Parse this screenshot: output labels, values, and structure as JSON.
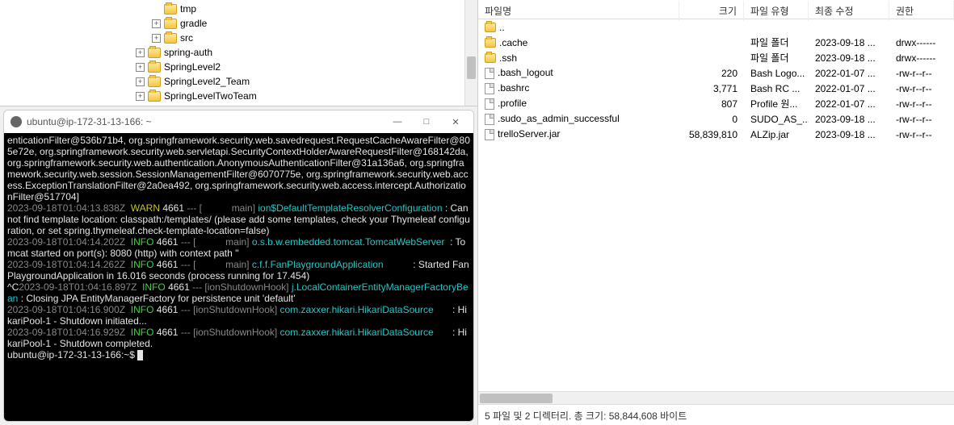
{
  "tree": {
    "items": [
      {
        "label": "tmp",
        "level": 2,
        "expander": ""
      },
      {
        "label": "gradle",
        "level": 2,
        "expander": "+"
      },
      {
        "label": "src",
        "level": 2,
        "expander": "+"
      },
      {
        "label": "spring-auth",
        "level": 1,
        "expander": "+"
      },
      {
        "label": "SpringLevel2",
        "level": 1,
        "expander": "+"
      },
      {
        "label": "SpringLevel2_Team",
        "level": 1,
        "expander": "+"
      },
      {
        "label": "SpringLevelTwoTeam",
        "level": 1,
        "expander": "+"
      }
    ]
  },
  "terminal": {
    "title": "ubuntu@ip-172-31-13-166: ~",
    "lines": [
      {
        "segments": [
          {
            "cls": "t-white",
            "text": "enticationFilter@536b71b4, org.springframework.security.web.savedrequest.RequestCacheAwareFilter@805e72e, org.springframework.security.web.servletapi.SecurityContextHolderAwareRequestFilter@168142da, org.springframework.security.web.authentication.AnonymousAuthenticationFilter@31a136a6, org.springframework.security.web.session.SessionManagementFilter@6070775e, org.springframework.security.web.access.ExceptionTranslationFilter@2a0ea492, org.springframework.security.web.access.intercept.AuthorizationFilter@517704]"
          }
        ]
      },
      {
        "segments": [
          {
            "cls": "t-grey",
            "text": "2023-09-18T01:04:13.838Z"
          },
          {
            "cls": "t-yellow",
            "text": "  WARN "
          },
          {
            "cls": "t-white",
            "text": "4661 "
          },
          {
            "cls": "t-grey",
            "text": "--- [           main] "
          },
          {
            "cls": "t-teal",
            "text": "ion$DefaultTemplateResolverConfiguration "
          },
          {
            "cls": "t-white",
            "text": ": Cannot find template location: classpath:/templates/ (please add some templates, check your Thymeleaf configuration, or set spring.thymeleaf.check-template-location=false)"
          }
        ]
      },
      {
        "segments": [
          {
            "cls": "t-grey",
            "text": "2023-09-18T01:04:14.202Z"
          },
          {
            "cls": "t-green",
            "text": "  INFO "
          },
          {
            "cls": "t-white",
            "text": "4661 "
          },
          {
            "cls": "t-grey",
            "text": "--- [           main] "
          },
          {
            "cls": "t-teal",
            "text": "o.s.b.w.embedded.tomcat.TomcatWebServer  "
          },
          {
            "cls": "t-white",
            "text": ": Tomcat started on port(s): 8080 (http) with context path ''"
          }
        ]
      },
      {
        "segments": [
          {
            "cls": "t-grey",
            "text": "2023-09-18T01:04:14.262Z"
          },
          {
            "cls": "t-green",
            "text": "  INFO "
          },
          {
            "cls": "t-white",
            "text": "4661 "
          },
          {
            "cls": "t-grey",
            "text": "--- [           main] "
          },
          {
            "cls": "t-teal",
            "text": "c.f.f.FanPlaygroundApplication           "
          },
          {
            "cls": "t-white",
            "text": ": Started FanPlaygroundApplication in 16.016 seconds (process running for 17.454)"
          }
        ]
      },
      {
        "segments": [
          {
            "cls": "t-white",
            "text": "^C"
          },
          {
            "cls": "t-grey",
            "text": "2023-09-18T01:04:16.897Z"
          },
          {
            "cls": "t-green",
            "text": "  INFO "
          },
          {
            "cls": "t-white",
            "text": "4661 "
          },
          {
            "cls": "t-grey",
            "text": "--- [ionShutdownHook] "
          },
          {
            "cls": "t-teal",
            "text": "j.LocalContainerEntityManagerFactoryBean "
          },
          {
            "cls": "t-white",
            "text": ": Closing JPA EntityManagerFactory for persistence unit 'default'"
          }
        ]
      },
      {
        "segments": [
          {
            "cls": "t-grey",
            "text": "2023-09-18T01:04:16.900Z"
          },
          {
            "cls": "t-green",
            "text": "  INFO "
          },
          {
            "cls": "t-white",
            "text": "4661 "
          },
          {
            "cls": "t-grey",
            "text": "--- [ionShutdownHook] "
          },
          {
            "cls": "t-teal",
            "text": "com.zaxxer.hikari.HikariDataSource       "
          },
          {
            "cls": "t-white",
            "text": ": HikariPool-1 - Shutdown initiated..."
          }
        ]
      },
      {
        "segments": [
          {
            "cls": "t-grey",
            "text": "2023-09-18T01:04:16.929Z"
          },
          {
            "cls": "t-green",
            "text": "  INFO "
          },
          {
            "cls": "t-white",
            "text": "4661 "
          },
          {
            "cls": "t-grey",
            "text": "--- [ionShutdownHook] "
          },
          {
            "cls": "t-teal",
            "text": "com.zaxxer.hikari.HikariDataSource       "
          },
          {
            "cls": "t-white",
            "text": ": HikariPool-1 - Shutdown completed."
          }
        ]
      },
      {
        "segments": [
          {
            "cls": "t-white",
            "text": "ubuntu@ip-172-31-13-166:~$ "
          }
        ],
        "cursor": true
      }
    ]
  },
  "file_list": {
    "headers": {
      "name": "파일명",
      "size": "크기",
      "type": "파일 유형",
      "date": "최종 수정",
      "perm": "권한"
    },
    "rows": [
      {
        "icon": "folder",
        "name": "..",
        "size": "",
        "type": "",
        "date": "",
        "perm": ""
      },
      {
        "icon": "folder",
        "name": ".cache",
        "size": "",
        "type": "파일 폴더",
        "date": "2023-09-18 ...",
        "perm": "drwx------"
      },
      {
        "icon": "folder",
        "name": ".ssh",
        "size": "",
        "type": "파일 폴더",
        "date": "2023-09-18 ...",
        "perm": "drwx------"
      },
      {
        "icon": "file",
        "name": ".bash_logout",
        "size": "220",
        "type": "Bash Logo...",
        "date": "2022-01-07 ...",
        "perm": "-rw-r--r--"
      },
      {
        "icon": "file",
        "name": ".bashrc",
        "size": "3,771",
        "type": "Bash RC ...",
        "date": "2022-01-07 ...",
        "perm": "-rw-r--r--"
      },
      {
        "icon": "file",
        "name": ".profile",
        "size": "807",
        "type": "Profile 원...",
        "date": "2022-01-07 ...",
        "perm": "-rw-r--r--"
      },
      {
        "icon": "file",
        "name": ".sudo_as_admin_successful",
        "size": "0",
        "type": "SUDO_AS_...",
        "date": "2023-09-18 ...",
        "perm": "-rw-r--r--"
      },
      {
        "icon": "file",
        "name": "trelloServer.jar",
        "size": "58,839,810",
        "type": "ALZip.jar",
        "date": "2023-09-18 ...",
        "perm": "-rw-r--r--"
      }
    ],
    "status": "5 파일 및 2 디렉터리. 총 크기: 58,844,608 바이트"
  }
}
